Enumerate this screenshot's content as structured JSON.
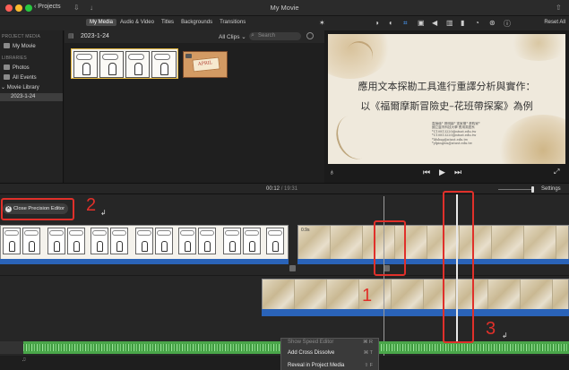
{
  "window": {
    "title": "My Movie",
    "back_label": "Projects"
  },
  "browser": {
    "tabs": [
      {
        "label": "My Media",
        "active": true
      },
      {
        "label": "Audio & Video",
        "active": false
      },
      {
        "label": "Titles",
        "active": false
      },
      {
        "label": "Backgrounds",
        "active": false
      },
      {
        "label": "Transitions",
        "active": false
      }
    ],
    "event_date": "2023-1-24",
    "filter_label": "All Clips ⌄",
    "search_placeholder": "Search"
  },
  "sidebar": {
    "project_media_head": "PROJECT MEDIA",
    "project_item": "My Movie",
    "libraries_head": "LIBRARIES",
    "items": [
      "Photos",
      "All Events",
      "Movie Library"
    ],
    "selected_event": "2023-1-24"
  },
  "clips": {
    "card_text": "APRIL"
  },
  "viewer": {
    "reset_label": "Reset All",
    "slide_title_line1": "應用文本探勘工具進行重譯分析與實作：",
    "slide_title_line2": "以《福爾摩斯冒險史–花班帶探案》為例",
    "slide_info": [
      "嘉禎倫* 張明諭* 憲家權* 張昀家*",
      "國立臺灣科技大學 應用英語系",
      "*C10813220@ntust.edu.tw",
      "*C10813220@ntust.edu.tw",
      "*ldshsg@ntust.edu.tw",
      "*ylpingwu@ntust.edu.tw"
    ]
  },
  "timeline": {
    "current_time": "00:12",
    "separator": "/",
    "total_time": "19:31",
    "settings_label": "Settings",
    "close_precision_label": "Close Precision Editor",
    "clip_duration": "0.9s"
  },
  "context_menu": {
    "items": [
      {
        "label": "Show Speed Editor",
        "shortcut": "⌘ R"
      },
      {
        "label": "Add Cross Dissolve",
        "shortcut": "⌘ T"
      },
      {
        "label": "Reveal in Project Media",
        "shortcut": "⇧ F"
      }
    ]
  },
  "annotations": {
    "num1": "1",
    "num2": "2",
    "num3": "3",
    "return_mark": "↲"
  },
  "colors": {
    "accent_red": "#e0302a",
    "clip_blue": "#2a63b8",
    "audio_green": "#4aa64a",
    "selection_yellow": "#e3b63d"
  }
}
